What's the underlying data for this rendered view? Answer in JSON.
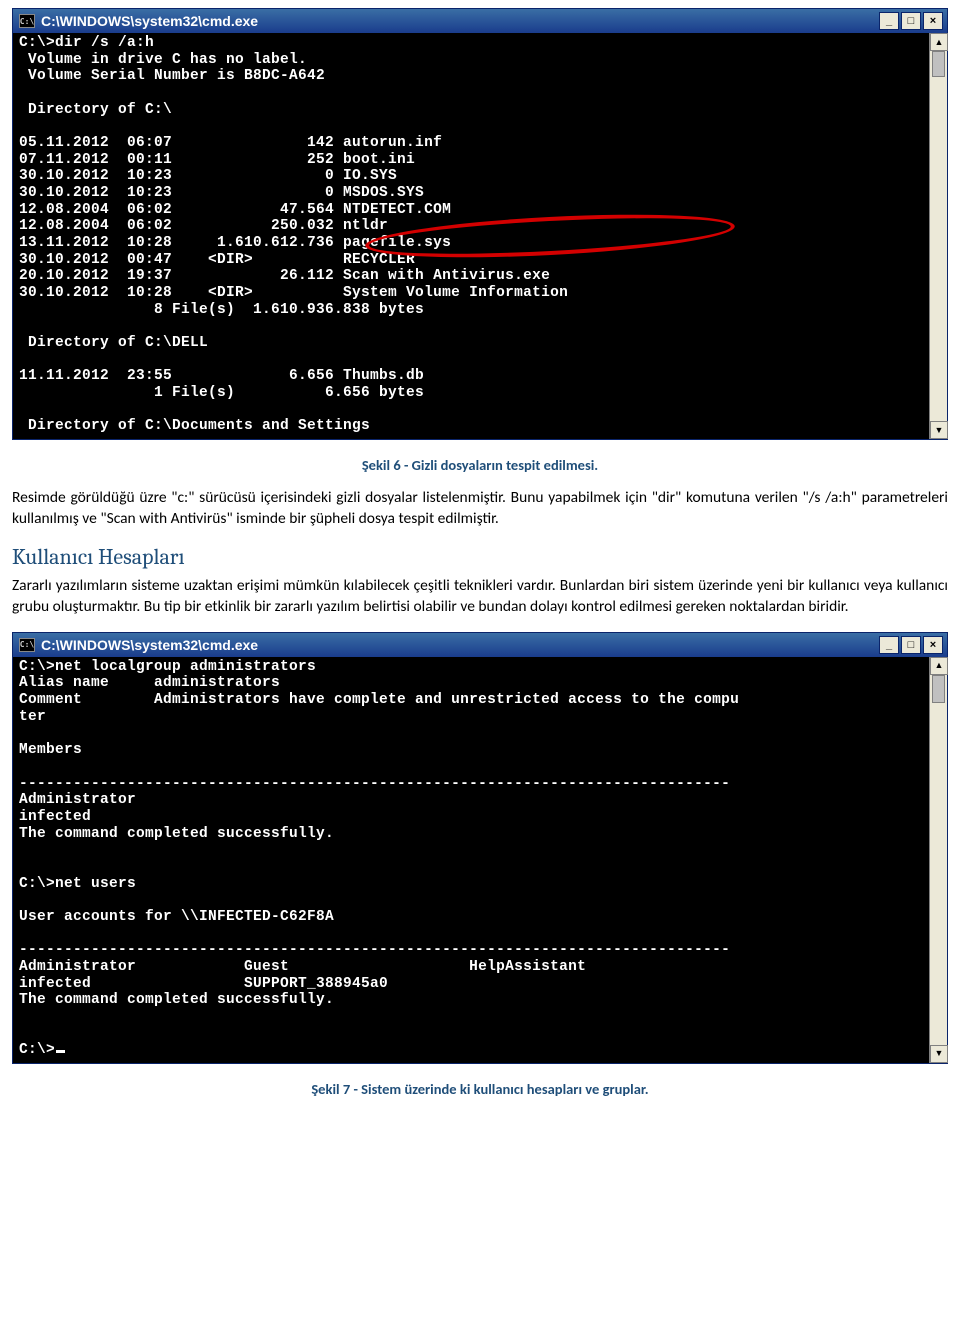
{
  "window1": {
    "title": "C:\\WINDOWS\\system32\\cmd.exe",
    "icon_label": "C:\\",
    "btn_min": "_",
    "btn_max": "□",
    "btn_close": "×",
    "lines": "C:\\>dir /s /a:h\n Volume in drive C has no label.\n Volume Serial Number is B8DC-A642\n\n Directory of C:\\\n\n05.11.2012  06:07               142 autorun.inf\n07.11.2012  00:11               252 boot.ini\n30.10.2012  10:23                 0 IO.SYS\n30.10.2012  10:23                 0 MSDOS.SYS\n12.08.2004  06:02            47.564 NTDETECT.COM\n12.08.2004  06:02           250.032 ntldr\n13.11.2012  10:28     1.610.612.736 pagefile.sys\n30.10.2012  00:47    <DIR>          RECYCLER\n20.10.2012  19:37            26.112 Scan with Antivirus.exe\n30.10.2012  10:28    <DIR>          System Volume Information\n               8 File(s)  1.610.936.838 bytes\n\n Directory of C:\\DELL\n\n11.11.2012  23:55             6.656 Thumbs.db\n               1 File(s)          6.656 bytes\n\n Directory of C:\\Documents and Settings"
  },
  "caption1": "Şekil 6 - Gizli dosyaların tespit edilmesi.",
  "para1": "Resimde görüldüğü üzre \"c:\" sürücüsü içerisindeki gizli dosyalar listelenmiştir. Bunu yapabilmek için \"dir\" komutuna verilen \"/s /a:h\" parametreleri kullanılmış ve \"Scan with Antivirüs\" isminde bir şüpheli dosya tespit edilmiştir.",
  "heading1": "Kullanıcı Hesapları",
  "para2": "Zararlı yazılımların sisteme uzaktan erişimi mümkün kılabilecek çeşitli teknikleri vardır. Bunlardan biri sistem üzerinde yeni bir kullanıcı veya kullanıcı grubu oluşturmaktır. Bu tip bir etkinlik bir zararlı yazılım belirtisi olabilir ve bundan dolayı kontrol edilmesi gereken noktalardan biridir.",
  "window2": {
    "title": "C:\\WINDOWS\\system32\\cmd.exe",
    "icon_label": "C:\\",
    "btn_min": "_",
    "btn_max": "□",
    "btn_close": "×",
    "lines": "C:\\>net localgroup administrators\nAlias name     administrators\nComment        Administrators have complete and unrestricted access to the compu\nter\n\nMembers\n\n-------------------------------------------------------------------------------\nAdministrator\ninfected\nThe command completed successfully.\n\n\nC:\\>net users\n\nUser accounts for \\\\INFECTED-C62F8A\n\n-------------------------------------------------------------------------------\nAdministrator            Guest                    HelpAssistant\ninfected                 SUPPORT_388945a0\nThe command completed successfully.\n\n\nC:\\>"
  },
  "caption2": "Şekil 7 - Sistem üzerinde ki kullanıcı hesapları ve gruplar."
}
